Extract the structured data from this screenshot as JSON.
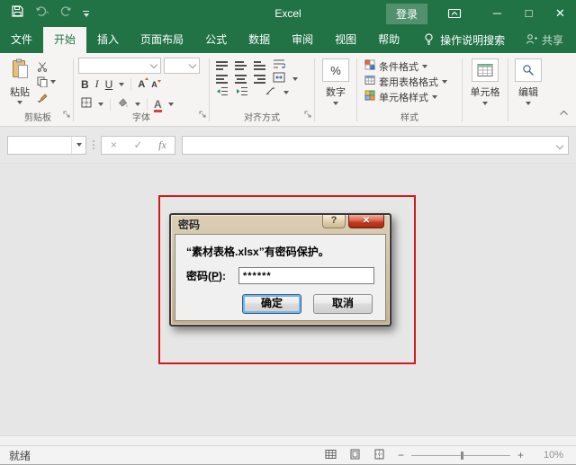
{
  "colors": {
    "excel_green": "#217346",
    "annotation_red": "#d31a1a",
    "default_button_glow": "#7ab3e0"
  },
  "titlebar": {
    "title": "Excel",
    "signin_label": "登录",
    "minimize_glyph": "─",
    "maximize_glyph": "□",
    "close_glyph": "✕"
  },
  "tabs": {
    "items": [
      {
        "label": "文件",
        "active": false
      },
      {
        "label": "开始",
        "active": true
      },
      {
        "label": "插入",
        "active": false
      },
      {
        "label": "页面布局",
        "active": false
      },
      {
        "label": "公式",
        "active": false
      },
      {
        "label": "数据",
        "active": false
      },
      {
        "label": "审阅",
        "active": false
      },
      {
        "label": "视图",
        "active": false
      },
      {
        "label": "帮助",
        "active": false
      }
    ],
    "tell_me_label": "操作说明搜索",
    "share_label": "共享"
  },
  "ribbon": {
    "clipboard": {
      "group_label": "剪贴板",
      "paste_label": "粘贴"
    },
    "font": {
      "group_label": "字体",
      "bold_glyph": "B",
      "italic_glyph": "I",
      "underline_glyph": "U",
      "grow_glyph": "A",
      "shrink_glyph": "A",
      "color_glyph": "A"
    },
    "alignment": {
      "group_label": "对齐方式"
    },
    "number": {
      "group_label": "数字",
      "percent_glyph": "%"
    },
    "styles": {
      "group_label": "样式",
      "conditional_label": "条件格式",
      "format_table_label": "套用表格格式",
      "cell_styles_label": "单元格样式"
    },
    "cells": {
      "group_label": "单元格"
    },
    "editing": {
      "group_label": "编辑"
    }
  },
  "formula_bar": {
    "namebox_value": "",
    "cancel_glyph": "×",
    "enter_glyph": "✓",
    "fx_label": "fx"
  },
  "dialog": {
    "title": "密码",
    "help_glyph": "?",
    "close_glyph": "✕",
    "message": "“素材表格.xlsx”有密码保护。",
    "password_label_pre": "密码(",
    "password_access_key": "P",
    "password_label_post": "):",
    "password_value": "******",
    "ok_label": "确定",
    "cancel_label": "取消"
  },
  "statusbar": {
    "ready_label": "就绪",
    "zoom_out_glyph": "−",
    "zoom_in_glyph": "+",
    "zoom_level": "10%"
  }
}
